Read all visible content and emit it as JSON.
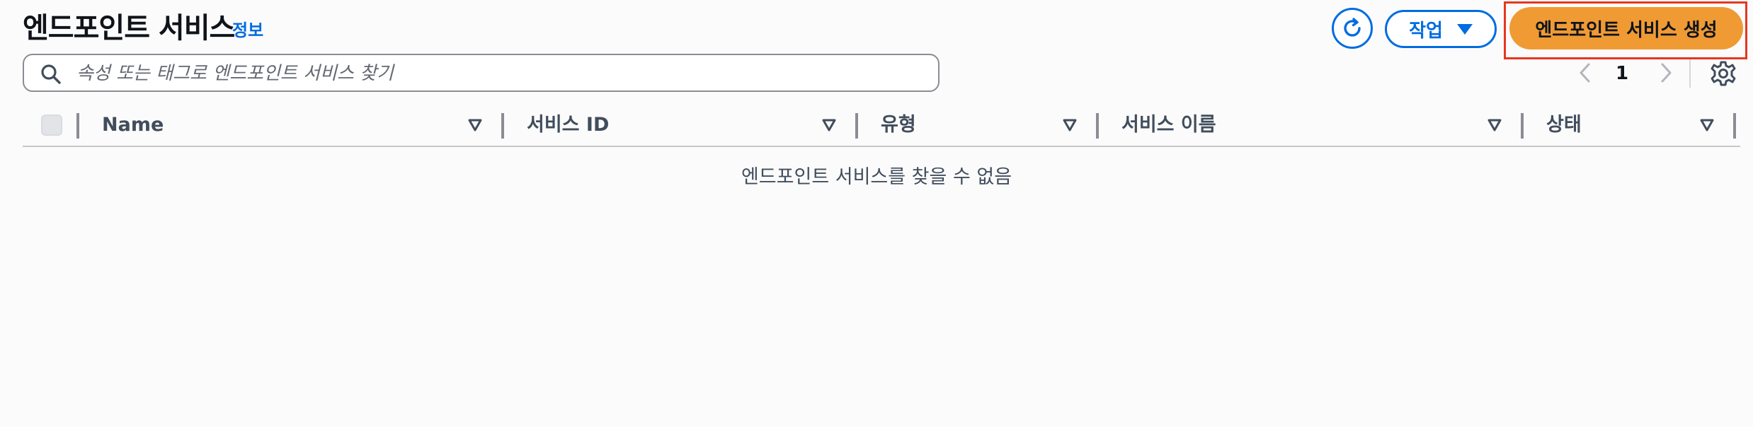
{
  "header": {
    "title": "엔드포인트 서비스",
    "info_link": "정보",
    "actions_label": "작업",
    "create_button": "엔드포인트 서비스 생성"
  },
  "search": {
    "placeholder": "속성 또는 태그로 엔드포인트 서비스 찾기",
    "value": ""
  },
  "pagination": {
    "current_page": "1"
  },
  "table": {
    "columns": [
      "Name",
      "서비스 ID",
      "유형",
      "서비스 이름",
      "상태"
    ],
    "rows": [],
    "empty_message": "엔드포인트 서비스를 찾을 수 없음"
  },
  "colors": {
    "accent": "#006ce0",
    "primary_button": "#f09a34",
    "highlight_box": "#e5371f"
  },
  "icons": [
    "refresh-icon",
    "caret-down-icon",
    "search-icon",
    "chevron-left-icon",
    "chevron-right-icon",
    "settings-icon",
    "sort-icon"
  ]
}
